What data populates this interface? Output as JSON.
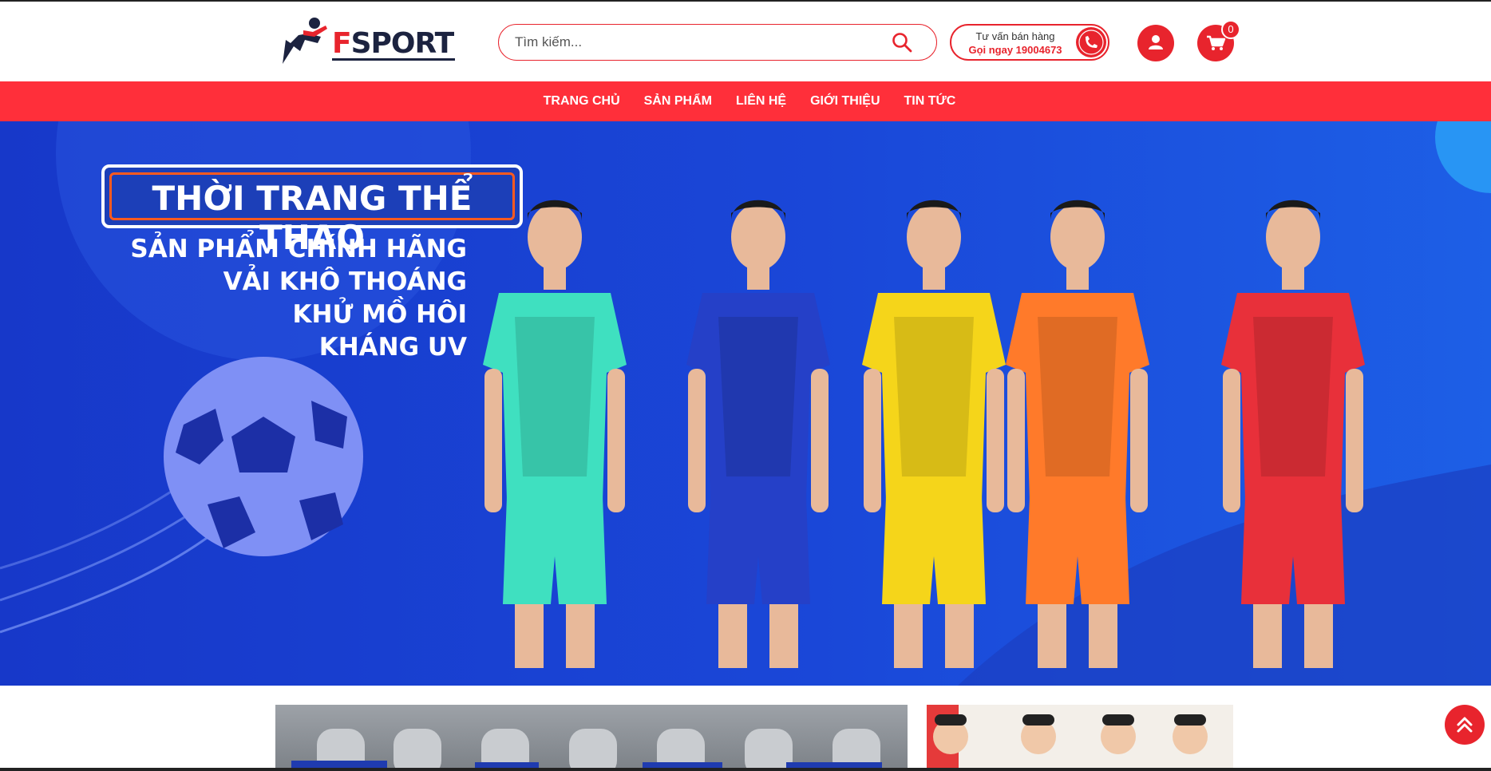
{
  "brand": {
    "name_first": "F",
    "name_rest": "SPORT",
    "accent": "#e8242d",
    "nav_bg": "#ff2f3a"
  },
  "search": {
    "placeholder": "Tìm kiếm...",
    "icon": "search-icon"
  },
  "hotline": {
    "line1": "Tư vấn bán hàng",
    "line2": "Gọi ngay 19004673",
    "icon": "phone-icon"
  },
  "account": {
    "icon": "user-icon"
  },
  "cart": {
    "icon": "cart-icon",
    "count": "0"
  },
  "nav": {
    "items": [
      {
        "label": "TRANG CHỦ"
      },
      {
        "label": "SẢN PHẨM"
      },
      {
        "label": "LIÊN HỆ"
      },
      {
        "label": "GIỚI THIỆU"
      },
      {
        "label": "TIN TỨC"
      }
    ]
  },
  "banner": {
    "title": "THỜI TRANG THỂ THAO",
    "slogans": [
      "SẢN PHẨM CHÍNH HÃNG",
      "VẢI KHÔ THOÁNG",
      "KHỬ MỒ HÔI",
      "KHÁNG UV"
    ],
    "kit_colors": [
      "#3fe0c0",
      "#2540c8",
      "#f5d51a",
      "#ff7a2a",
      "#e8303a"
    ]
  },
  "scroll_top": {
    "icon": "double-chevron-up-icon"
  }
}
